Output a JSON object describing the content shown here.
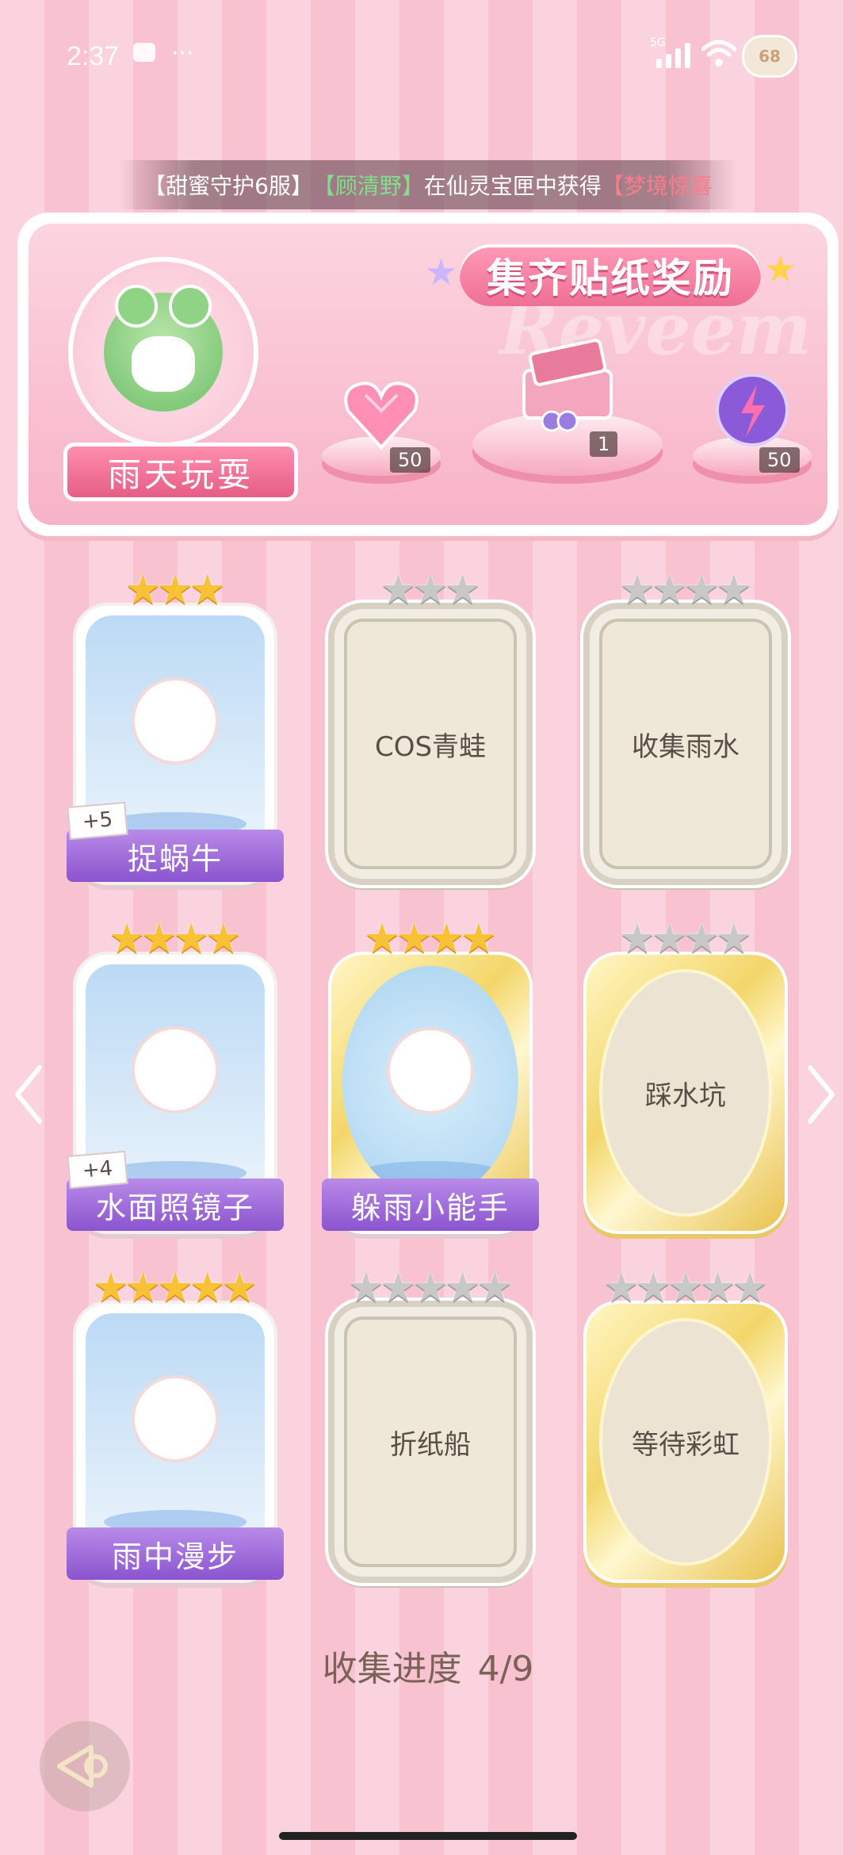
{
  "status_bar": {
    "time": "2:37",
    "dots": "···",
    "network": "5G",
    "battery": "68"
  },
  "ticker": {
    "part1": "【甜蜜守护6服】",
    "name": "【顾清野】",
    "part2": "在仙灵宝匣中获得",
    "item": "【梦境惊喜"
  },
  "banner": {
    "title": "集齐贴纸奖励",
    "watermark": "Reveem",
    "theme_label": "雨天玩耍",
    "rewards": [
      {
        "icon": "pink-heart-gem-icon",
        "qty": "50"
      },
      {
        "icon": "gift-box-icon",
        "qty": "1"
      },
      {
        "icon": "purple-energy-orb-icon",
        "qty": "50"
      }
    ]
  },
  "cards": [
    {
      "label": "捉蜗牛",
      "stars_filled": 3,
      "stars_total": 3,
      "collected": true,
      "style": "square",
      "bonus": "+5"
    },
    {
      "label": "COS青蛙",
      "stars_filled": 0,
      "stars_total": 3,
      "collected": false,
      "style": "square"
    },
    {
      "label": "收集雨水",
      "stars_filled": 0,
      "stars_total": 4,
      "collected": false,
      "style": "square"
    },
    {
      "label": "水面照镜子",
      "stars_filled": 4,
      "stars_total": 4,
      "collected": true,
      "style": "square",
      "bonus": "+4"
    },
    {
      "label": "躲雨小能手",
      "stars_filled": 4,
      "stars_total": 4,
      "collected": true,
      "style": "oval"
    },
    {
      "label": "踩水坑",
      "stars_filled": 0,
      "stars_total": 4,
      "collected": false,
      "style": "oval"
    },
    {
      "label": "雨中漫步",
      "stars_filled": 5,
      "stars_total": 5,
      "collected": true,
      "style": "square"
    },
    {
      "label": "折纸船",
      "stars_filled": 0,
      "stars_total": 5,
      "collected": false,
      "style": "square"
    },
    {
      "label": "等待彩虹",
      "stars_filled": 0,
      "stars_total": 5,
      "collected": false,
      "style": "oval"
    }
  ],
  "progress": {
    "label": "收集进度",
    "value": "4/9"
  },
  "colors": {
    "accent_pink": "#ef6f95",
    "ribbon_purple": "#8a54cf",
    "star_gold": "#f8c236"
  }
}
